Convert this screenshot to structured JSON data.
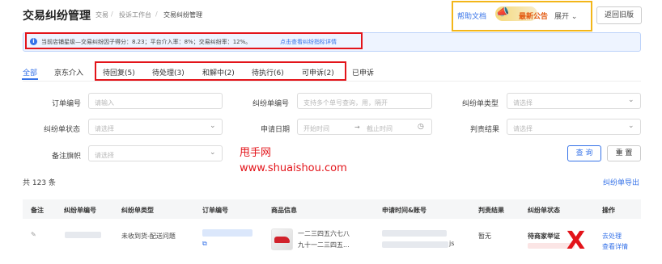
{
  "header": {
    "title": "交易纠纷管理",
    "breadcrumb": [
      "交易",
      "投诉工作台",
      "交易纠纷管理"
    ],
    "help": "帮助文档",
    "news": "最新公告",
    "expand": "展开",
    "old_version": "返回旧版"
  },
  "info": {
    "text": "当前店铺星级—交易纠纷因子得分：8.23；平台介入率：8%；交易纠纷率：12%。",
    "link": "点击查看纠纷指标详情"
  },
  "tabs": [
    {
      "label": "全部",
      "active": true
    },
    {
      "label": "京东介入"
    },
    {
      "label": "待回复(5)"
    },
    {
      "label": "待处理(3)"
    },
    {
      "label": "和解中(2)"
    },
    {
      "label": "待执行(6)"
    },
    {
      "label": "可申诉(2)"
    },
    {
      "label": "已申诉"
    }
  ],
  "filters": {
    "order_no": {
      "label": "订单编号",
      "placeholder": "请输入"
    },
    "dispute_no": {
      "label": "纠纷单编号",
      "placeholder": "支持多个单号查询，用，隔开"
    },
    "dispute_type": {
      "label": "纠纷单类型",
      "placeholder": "请选择"
    },
    "dispute_status": {
      "label": "纠纷单状态",
      "placeholder": "请选择"
    },
    "apply_date": {
      "label": "申请日期",
      "start": "开始时间",
      "end": "截止时间"
    },
    "judgement": {
      "label": "判责结果",
      "placeholder": "请选择"
    },
    "remark_flag": {
      "label": "备注旗帜",
      "placeholder": "请选择"
    }
  },
  "buttons": {
    "query": "查 询",
    "reset": "重 置"
  },
  "watermark": {
    "line1": "甩手网",
    "line2": "www.shuaishou.com"
  },
  "summary": {
    "total": "共 123 条",
    "export": "纠纷单导出"
  },
  "table": {
    "headers": [
      "备注",
      "纠纷单编号",
      "纠纷单类型",
      "订单编号",
      "商品信息",
      "申请时间&账号",
      "判责结果",
      "纠纷单状态",
      "操作"
    ],
    "rows": [
      {
        "dispute_type": "未收到货-配送问题",
        "product_line1": "一二三四五六七八",
        "product_line2": "九十一二三四五...",
        "account_suffix": "js",
        "judgement": "暂无",
        "status": "待商家举证",
        "action1": "去处理",
        "action2": "查看详情"
      }
    ]
  }
}
